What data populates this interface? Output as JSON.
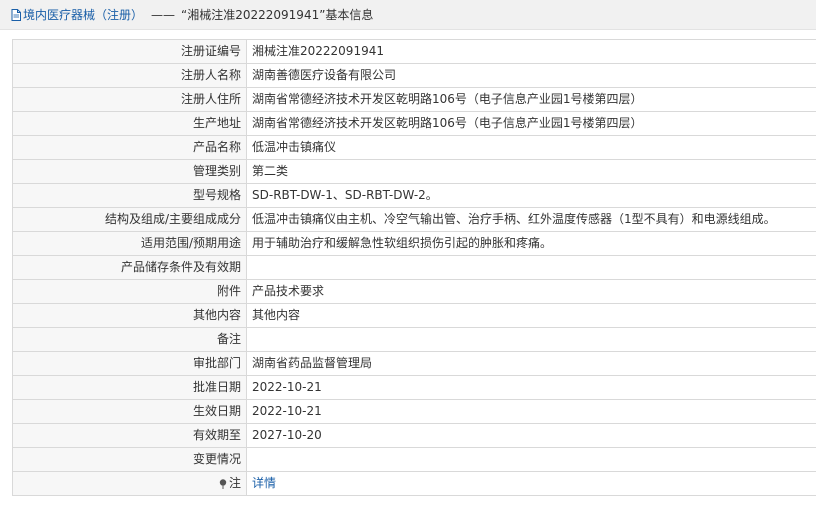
{
  "breadcrumb": {
    "category": "境内医疗器械（注册）",
    "separator": "——",
    "current": "“湘械注准20222091941”基本信息"
  },
  "rows": [
    {
      "label": "注册证编号",
      "value": "湘械注准20222091941"
    },
    {
      "label": "注册人名称",
      "value": "湖南善德医疗设备有限公司"
    },
    {
      "label": "注册人住所",
      "value": "湖南省常德经济技术开发区乾明路106号（电子信息产业园1号楼第四层）"
    },
    {
      "label": "生产地址",
      "value": "湖南省常德经济技术开发区乾明路106号（电子信息产业园1号楼第四层）"
    },
    {
      "label": "产品名称",
      "value": "低温冲击镇痛仪"
    },
    {
      "label": "管理类别",
      "value": "第二类"
    },
    {
      "label": "型号规格",
      "value": "SD-RBT-DW-1、SD-RBT-DW-2。"
    },
    {
      "label": "结构及组成/主要组成成分",
      "value": "低温冲击镇痛仪由主机、冷空气输出管、治疗手柄、红外温度传感器（1型不具有）和电源线组成。"
    },
    {
      "label": "适用范围/预期用途",
      "value": "用于辅助治疗和缓解急性软组织损伤引起的肿胀和疼痛。"
    },
    {
      "label": "产品储存条件及有效期",
      "value": ""
    },
    {
      "label": "附件",
      "value": "产品技术要求"
    },
    {
      "label": "其他内容",
      "value": "其他内容"
    },
    {
      "label": "备注",
      "value": ""
    },
    {
      "label": "审批部门",
      "value": "湖南省药品监督管理局"
    },
    {
      "label": "批准日期",
      "value": "2022-10-21"
    },
    {
      "label": "生效日期",
      "value": "2022-10-21"
    },
    {
      "label": "有效期至",
      "value": "2027-10-20"
    },
    {
      "label": "变更情况",
      "value": ""
    }
  ],
  "note_row": {
    "label": "注",
    "link": "详情",
    "icon": "pin-icon"
  },
  "colors": {
    "link": "#1a5fa8",
    "label_bg": "#f7f7f7",
    "border": "#d9d9d9",
    "header_bg": "#f1f1f1"
  }
}
